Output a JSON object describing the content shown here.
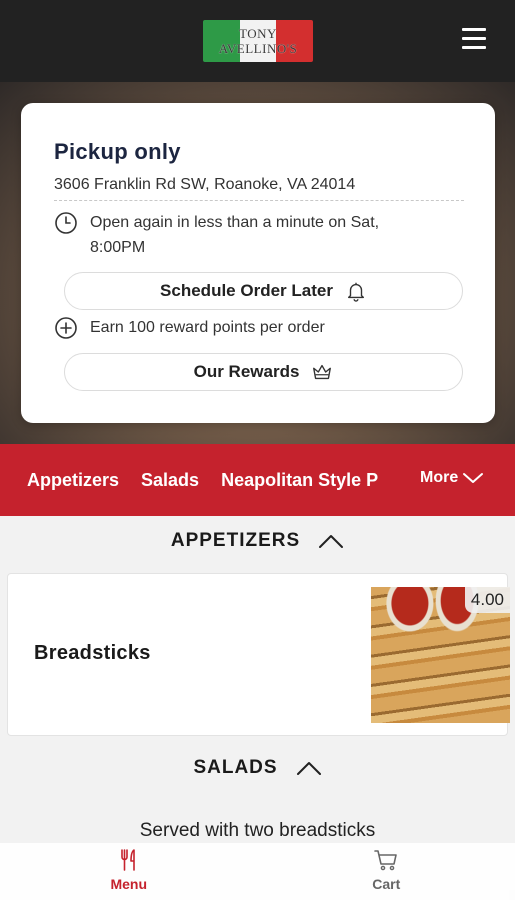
{
  "header": {
    "logo_line1": "TONY",
    "logo_line2": "AVELLINO'S",
    "menu_icon": "hamburger-icon"
  },
  "info_card": {
    "title": "Pickup only",
    "address": "3606 Franklin Rd SW, Roanoke, VA 24014",
    "open_status": "Open again in less than a minute on Sat, 8:00PM",
    "schedule_button": "Schedule Order Later",
    "schedule_icon": "bell-icon",
    "rewards_text": "Earn 100 reward points per order",
    "rewards_button": "Our Rewards",
    "rewards_icon": "crown-icon",
    "open_icon": "clock-icon",
    "earn_icon": "plus-circle-icon"
  },
  "categories": {
    "items": [
      "Appetizers",
      "Salads",
      "Neapolitan Style P"
    ],
    "more_label": "More"
  },
  "sections": [
    {
      "title": "APPETIZERS",
      "items": [
        {
          "name": "Breadsticks",
          "price": "4.00"
        }
      ]
    },
    {
      "title": "SALADS",
      "note": "Served with two breadsticks"
    }
  ],
  "bottom_nav": {
    "menu_label": "Menu",
    "cart_label": "Cart",
    "active": "Menu"
  },
  "colors": {
    "brand_red": "#c5222d",
    "header_dark": "#222222",
    "title_navy": "#1c2540"
  }
}
